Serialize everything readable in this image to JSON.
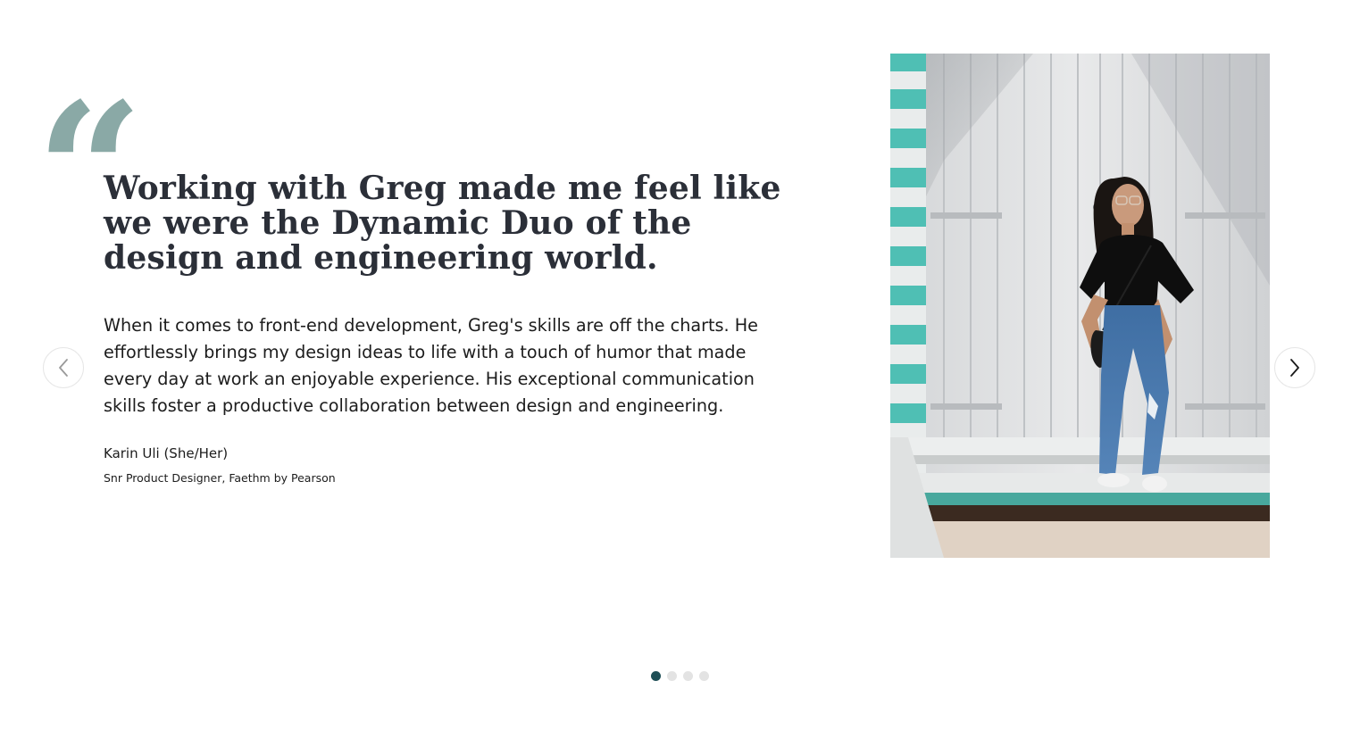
{
  "testimonial": {
    "quote_mark": "“",
    "headline": "Working with Greg made me feel like we were the Dynamic Duo of the design and engineering world.",
    "body": "When it comes to front-end development, Greg's skills are off the charts. He effortlessly brings my design ideas to life with a touch of humor that made every day at work an enjoyable experience. His exceptional communication skills foster a productive collaboration between design and engineering.",
    "author": "Karin Uli (She/Her)",
    "role": "Snr Product Designer, Faethm by Pearson"
  },
  "navigation": {
    "prev_icon": "chevron-left-icon",
    "next_icon": "chevron-right-icon"
  },
  "pagination": {
    "total": 4,
    "active_index": 0
  },
  "colors": {
    "quote_mark": "#8aa9a6",
    "headline": "#2b2f38",
    "active_dot": "#1f4f56",
    "inactive_dot": "#e3e3e3"
  }
}
